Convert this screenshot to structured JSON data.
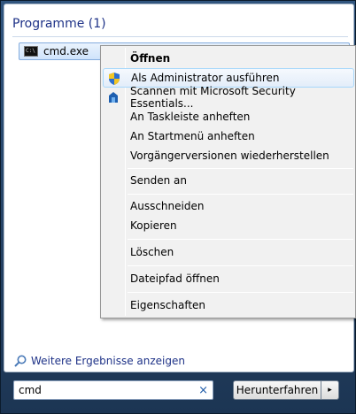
{
  "results": {
    "group_title": "Programme (1)",
    "items": [
      {
        "label": "cmd.exe",
        "icon": "cmd-icon"
      }
    ],
    "more_results": "Weitere Ergebnisse anzeigen"
  },
  "context_menu": {
    "items": [
      {
        "label": "Öffnen",
        "bold": true
      },
      {
        "label": "Als Administrator ausführen",
        "icon": "uac-shield-icon",
        "hover": true
      },
      {
        "label": "Scannen mit Microsoft Security Essentials...",
        "icon": "security-essentials-icon"
      },
      {
        "label": "An Taskleiste anheften"
      },
      {
        "label": "An Startmenü anheften"
      },
      {
        "label": "Vorgängerversionen wiederherstellen"
      },
      {
        "label": "Senden an"
      },
      {
        "label": "Ausschneiden"
      },
      {
        "label": "Kopieren"
      },
      {
        "label": "Löschen"
      },
      {
        "label": "Dateipfad öffnen"
      },
      {
        "label": "Eigenschaften"
      }
    ]
  },
  "search": {
    "value": "cmd",
    "clear_glyph": "×"
  },
  "shutdown": {
    "label": "Herunterfahren",
    "arrow_glyph": "▸"
  },
  "colors": {
    "accent": "#1e3287",
    "hover_border": "#a8d8fb"
  }
}
